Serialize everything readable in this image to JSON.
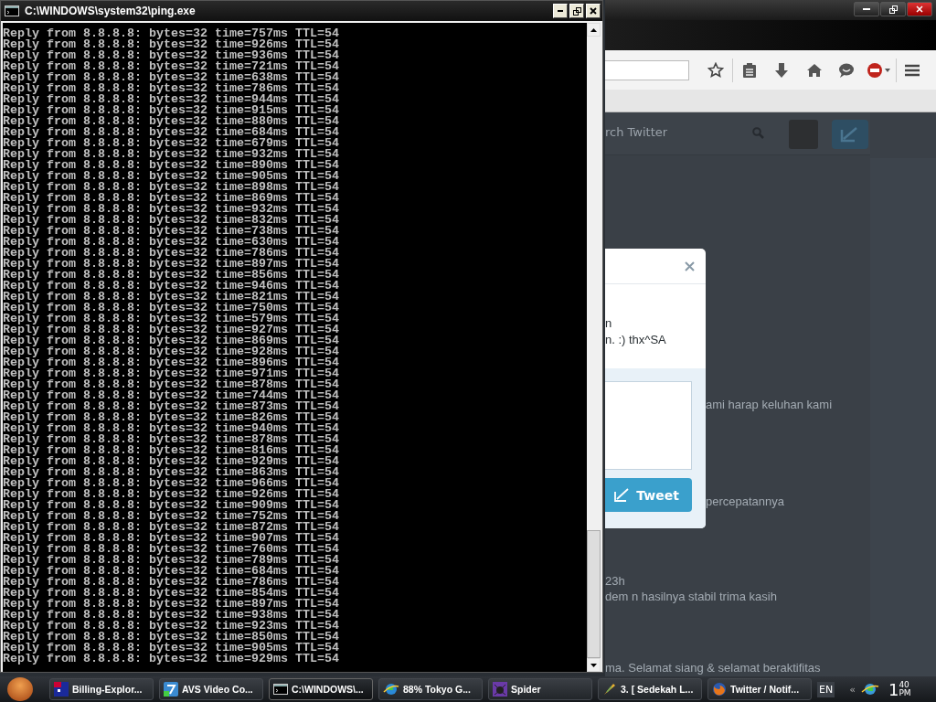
{
  "browser_window": {
    "search_placeholder": "rch Twitter",
    "modal": {
      "lines": [
        "n",
        "n. :) thx^SA"
      ],
      "tweet_button": "Tweet"
    },
    "timeline_texts": [
      "ami harap keluhan kami",
      "percepatannya",
      "23h",
      "dem n hasilnya stabil trima kasih",
      "ma. Selamat siang & selamat beraktifitas"
    ]
  },
  "console_window": {
    "title": "C:\\WINDOWS\\system32\\ping.exe",
    "lines": [
      "Reply from 8.8.8.8: bytes=32 time=757ms TTL=54",
      "Reply from 8.8.8.8: bytes=32 time=926ms TTL=54",
      "Reply from 8.8.8.8: bytes=32 time=936ms TTL=54",
      "Reply from 8.8.8.8: bytes=32 time=721ms TTL=54",
      "Reply from 8.8.8.8: bytes=32 time=638ms TTL=54",
      "Reply from 8.8.8.8: bytes=32 time=786ms TTL=54",
      "Reply from 8.8.8.8: bytes=32 time=944ms TTL=54",
      "Reply from 8.8.8.8: bytes=32 time=915ms TTL=54",
      "Reply from 8.8.8.8: bytes=32 time=880ms TTL=54",
      "Reply from 8.8.8.8: bytes=32 time=684ms TTL=54",
      "Reply from 8.8.8.8: bytes=32 time=679ms TTL=54",
      "Reply from 8.8.8.8: bytes=32 time=932ms TTL=54",
      "Reply from 8.8.8.8: bytes=32 time=890ms TTL=54",
      "Reply from 8.8.8.8: bytes=32 time=905ms TTL=54",
      "Reply from 8.8.8.8: bytes=32 time=898ms TTL=54",
      "Reply from 8.8.8.8: bytes=32 time=869ms TTL=54",
      "Reply from 8.8.8.8: bytes=32 time=932ms TTL=54",
      "Reply from 8.8.8.8: bytes=32 time=832ms TTL=54",
      "Reply from 8.8.8.8: bytes=32 time=738ms TTL=54",
      "Reply from 8.8.8.8: bytes=32 time=630ms TTL=54",
      "Reply from 8.8.8.8: bytes=32 time=786ms TTL=54",
      "Reply from 8.8.8.8: bytes=32 time=897ms TTL=54",
      "Reply from 8.8.8.8: bytes=32 time=856ms TTL=54",
      "Reply from 8.8.8.8: bytes=32 time=946ms TTL=54",
      "Reply from 8.8.8.8: bytes=32 time=821ms TTL=54",
      "Reply from 8.8.8.8: bytes=32 time=750ms TTL=54",
      "Reply from 8.8.8.8: bytes=32 time=579ms TTL=54",
      "Reply from 8.8.8.8: bytes=32 time=927ms TTL=54",
      "Reply from 8.8.8.8: bytes=32 time=869ms TTL=54",
      "Reply from 8.8.8.8: bytes=32 time=928ms TTL=54",
      "Reply from 8.8.8.8: bytes=32 time=896ms TTL=54",
      "Reply from 8.8.8.8: bytes=32 time=971ms TTL=54",
      "Reply from 8.8.8.8: bytes=32 time=878ms TTL=54",
      "Reply from 8.8.8.8: bytes=32 time=744ms TTL=54",
      "Reply from 8.8.8.8: bytes=32 time=873ms TTL=54",
      "Reply from 8.8.8.8: bytes=32 time=826ms TTL=54",
      "Reply from 8.8.8.8: bytes=32 time=940ms TTL=54",
      "Reply from 8.8.8.8: bytes=32 time=878ms TTL=54",
      "Reply from 8.8.8.8: bytes=32 time=816ms TTL=54",
      "Reply from 8.8.8.8: bytes=32 time=929ms TTL=54",
      "Reply from 8.8.8.8: bytes=32 time=863ms TTL=54",
      "Reply from 8.8.8.8: bytes=32 time=966ms TTL=54",
      "Reply from 8.8.8.8: bytes=32 time=926ms TTL=54",
      "Reply from 8.8.8.8: bytes=32 time=909ms TTL=54",
      "Reply from 8.8.8.8: bytes=32 time=752ms TTL=54",
      "Reply from 8.8.8.8: bytes=32 time=872ms TTL=54",
      "Reply from 8.8.8.8: bytes=32 time=907ms TTL=54",
      "Reply from 8.8.8.8: bytes=32 time=760ms TTL=54",
      "Reply from 8.8.8.8: bytes=32 time=789ms TTL=54",
      "Reply from 8.8.8.8: bytes=32 time=684ms TTL=54",
      "Reply from 8.8.8.8: bytes=32 time=786ms TTL=54",
      "Reply from 8.8.8.8: bytes=32 time=854ms TTL=54",
      "Reply from 8.8.8.8: bytes=32 time=897ms TTL=54",
      "Reply from 8.8.8.8: bytes=32 time=938ms TTL=54",
      "Reply from 8.8.8.8: bytes=32 time=923ms TTL=54",
      "Reply from 8.8.8.8: bytes=32 time=850ms TTL=54",
      "Reply from 8.8.8.8: bytes=32 time=905ms TTL=54",
      "Reply from 8.8.8.8: bytes=32 time=929ms TTL=54"
    ]
  },
  "taskbar": {
    "items": [
      {
        "label": "Billing-Explor...",
        "kind": "flag",
        "selected": false
      },
      {
        "label": "AVS Video Co...",
        "kind": "video",
        "selected": false
      },
      {
        "label": "C:\\WINDOWS\\...",
        "kind": "console",
        "selected": true
      },
      {
        "label": "88% Tokyo G...",
        "kind": "globe",
        "selected": false
      },
      {
        "label": "Spider",
        "kind": "spider",
        "selected": false
      },
      {
        "label": "3. [ Sedekah L...",
        "kind": "pen",
        "selected": false
      },
      {
        "label": "Twitter / Notif...",
        "kind": "fox",
        "selected": false
      }
    ],
    "language": "EN",
    "overflow": "«",
    "clock": {
      "hour": "1",
      "minute": "40",
      "period": "PM"
    }
  }
}
